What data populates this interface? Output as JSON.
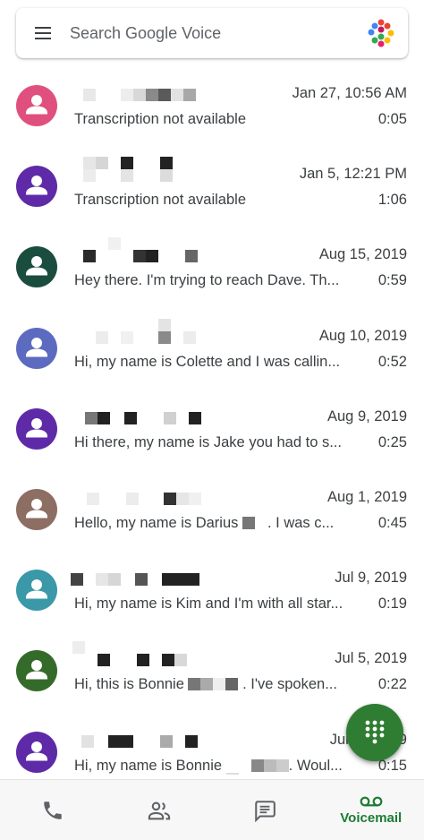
{
  "search": {
    "placeholder": "Search Google Voice"
  },
  "colors": {
    "accent": "#2e7d32",
    "text": "#3c4043"
  },
  "voicemails": [
    {
      "date": "Jan 27, 10:56 AM",
      "snippet": "Transcription not available",
      "duration": "0:05",
      "avatar_color": "#e0507e"
    },
    {
      "date": "Jan 5, 12:21 PM",
      "snippet": "Transcription not available",
      "duration": "1:06",
      "avatar_color": "#5e2aa8"
    },
    {
      "date": "Aug 15, 2019",
      "snippet": "Hey there. I'm trying to reach Dave. Th...",
      "duration": "0:59",
      "avatar_color": "#1a4d3e"
    },
    {
      "date": "Aug 10, 2019",
      "snippet": "Hi, my name is Colette and I was callin...",
      "duration": "0:52",
      "avatar_color": "#5c6bc0"
    },
    {
      "date": "Aug 9, 2019",
      "snippet": "Hi there, my name is Jake you had to s...",
      "duration": "0:25",
      "avatar_color": "#5e2aa8"
    },
    {
      "date": "Aug 1, 2019",
      "snippet_a": "Hello, my name is Darius",
      "snippet_b": ". I was c...",
      "duration": "0:45",
      "avatar_color": "#8d6e63"
    },
    {
      "date": "Jul 9, 2019",
      "snippet": "Hi, my name is Kim and I'm with all star...",
      "duration": "0:19",
      "avatar_color": "#3a98a8"
    },
    {
      "date": "Jul 5, 2019",
      "snippet_a": "Hi, this is Bonnie",
      "snippet_b": ". I've spoken...",
      "duration": "0:22",
      "avatar_color": "#356b2a"
    },
    {
      "date": "Jun 2, 2019",
      "snippet_a": "Hi, my name is Bonnie",
      "snippet_b": ". Woul...",
      "duration": "0:15",
      "avatar_color": "#5e2aa8"
    }
  ],
  "nav": {
    "calls_icon": "phone-icon",
    "contacts_icon": "contacts-icon",
    "messages_icon": "message-icon",
    "voicemail_label": "Voicemail",
    "voicemail_icon": "voicemail-icon"
  },
  "fab_icon": "dialpad-icon"
}
